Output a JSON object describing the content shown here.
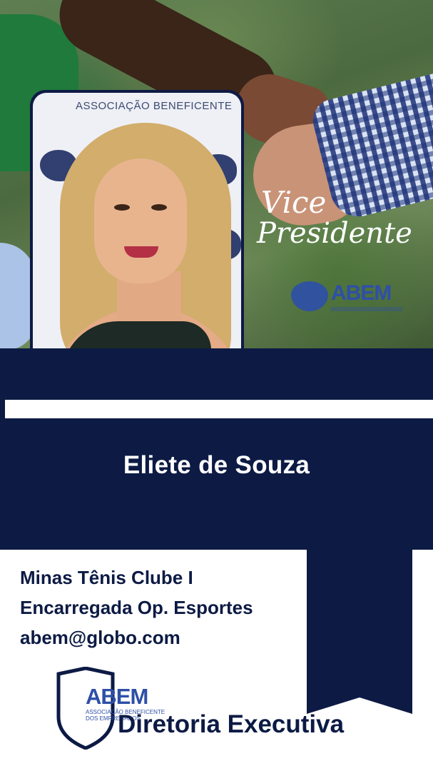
{
  "hero": {
    "role_line1": "Vice",
    "role_line2": "Presidente",
    "logo_text": "ABEM",
    "backdrop_text": "ASSOCIAÇÃO BENEFICENTE"
  },
  "profile": {
    "name": "Eliete de Souza",
    "club": "Minas Tênis Clube I",
    "position": "Encarregada Op. Esportes",
    "email": "abem@globo.com"
  },
  "footer": {
    "logo_text": "ABEM",
    "logo_subtext_line1": "ASSOCIAÇÃO BENEFICENTE",
    "logo_subtext_line2": "DOS EMPREGADOS",
    "title": "Diretoria Executiva"
  },
  "colors": {
    "navy": "#0c1a44",
    "brand_blue": "#2e4fa8",
    "white": "#ffffff"
  }
}
